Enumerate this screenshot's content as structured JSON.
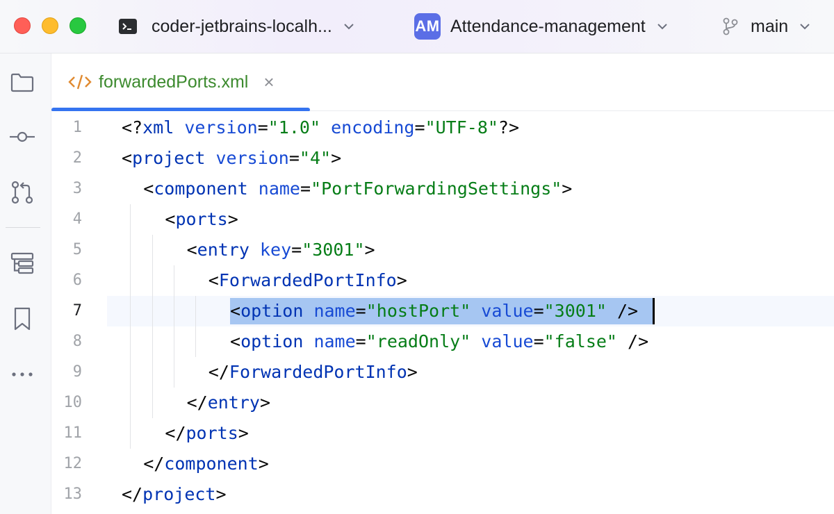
{
  "titlebar": {
    "remote": "coder-jetbrains-localh...",
    "project_badge": "AM",
    "project": "Attendance-management",
    "branch": "main"
  },
  "colors": {
    "accent": "#3574f0",
    "selection": "#a6c6f2",
    "badge": "#5b6ee6",
    "tag": "#0033b3",
    "attribute": "#174ad4",
    "value": "#067d17"
  },
  "toolstrip": [
    "folder-icon",
    "commit-icon",
    "pull-requests-icon",
    "structure-icon",
    "bookmarks-icon",
    "more-icon"
  ],
  "tab": {
    "label": "forwardedPorts.xml",
    "close": "×"
  },
  "editor": {
    "current_line": 7,
    "lines": [
      {
        "n": "1",
        "indent": 0,
        "tokens": [
          [
            "br",
            "<?"
          ],
          [
            "tag",
            "xml"
          ],
          [
            "br",
            " "
          ],
          [
            "attr",
            "version"
          ],
          [
            "br",
            "="
          ],
          [
            "val",
            "\"1.0\""
          ],
          [
            "br",
            " "
          ],
          [
            "attr",
            "encoding"
          ],
          [
            "br",
            "="
          ],
          [
            "val",
            "\"UTF-8\""
          ],
          [
            "br",
            "?>"
          ]
        ]
      },
      {
        "n": "2",
        "indent": 0,
        "tokens": [
          [
            "br",
            "<"
          ],
          [
            "tag",
            "project"
          ],
          [
            "br",
            " "
          ],
          [
            "attr",
            "version"
          ],
          [
            "br",
            "="
          ],
          [
            "val",
            "\"4\""
          ],
          [
            "br",
            ">"
          ]
        ]
      },
      {
        "n": "3",
        "indent": 1,
        "tokens": [
          [
            "br",
            "<"
          ],
          [
            "tag",
            "component"
          ],
          [
            "br",
            " "
          ],
          [
            "attr",
            "name"
          ],
          [
            "br",
            "="
          ],
          [
            "val",
            "\"PortForwardingSettings\""
          ],
          [
            "br",
            ">"
          ]
        ]
      },
      {
        "n": "4",
        "indent": 2,
        "tokens": [
          [
            "br",
            "<"
          ],
          [
            "tag",
            "ports"
          ],
          [
            "br",
            ">"
          ]
        ]
      },
      {
        "n": "5",
        "indent": 3,
        "tokens": [
          [
            "br",
            "<"
          ],
          [
            "tag",
            "entry"
          ],
          [
            "br",
            " "
          ],
          [
            "attr",
            "key"
          ],
          [
            "br",
            "="
          ],
          [
            "val",
            "\"3001\""
          ],
          [
            "br",
            ">"
          ]
        ]
      },
      {
        "n": "6",
        "indent": 4,
        "tokens": [
          [
            "br",
            "<"
          ],
          [
            "tag",
            "ForwardedPortInfo"
          ],
          [
            "br",
            ">"
          ]
        ]
      },
      {
        "n": "7",
        "indent": 5,
        "tokens": [
          [
            "br",
            "<"
          ],
          [
            "tag",
            "option"
          ],
          [
            "br",
            " "
          ],
          [
            "attr",
            "name"
          ],
          [
            "br",
            "="
          ],
          [
            "val",
            "\"hostPort\""
          ],
          [
            "br",
            " "
          ],
          [
            "attr",
            "value"
          ],
          [
            "br",
            "="
          ],
          [
            "val",
            "\"3001\""
          ],
          [
            "br",
            " />"
          ]
        ]
      },
      {
        "n": "8",
        "indent": 5,
        "tokens": [
          [
            "br",
            "<"
          ],
          [
            "tag",
            "option"
          ],
          [
            "br",
            " "
          ],
          [
            "attr",
            "name"
          ],
          [
            "br",
            "="
          ],
          [
            "val",
            "\"readOnly\""
          ],
          [
            "br",
            " "
          ],
          [
            "attr",
            "value"
          ],
          [
            "br",
            "="
          ],
          [
            "val",
            "\"false\""
          ],
          [
            "br",
            " />"
          ]
        ]
      },
      {
        "n": "9",
        "indent": 4,
        "tokens": [
          [
            "br",
            "</"
          ],
          [
            "tag",
            "ForwardedPortInfo"
          ],
          [
            "br",
            ">"
          ]
        ]
      },
      {
        "n": "10",
        "indent": 3,
        "tokens": [
          [
            "br",
            "</"
          ],
          [
            "tag",
            "entry"
          ],
          [
            "br",
            ">"
          ]
        ]
      },
      {
        "n": "11",
        "indent": 2,
        "tokens": [
          [
            "br",
            "</"
          ],
          [
            "tag",
            "ports"
          ],
          [
            "br",
            ">"
          ]
        ]
      },
      {
        "n": "12",
        "indent": 1,
        "tokens": [
          [
            "br",
            "</"
          ],
          [
            "tag",
            "component"
          ],
          [
            "br",
            ">"
          ]
        ]
      },
      {
        "n": "13",
        "indent": 0,
        "tokens": [
          [
            "br",
            "</"
          ],
          [
            "tag",
            "project"
          ],
          [
            "br",
            ">"
          ]
        ]
      }
    ]
  }
}
